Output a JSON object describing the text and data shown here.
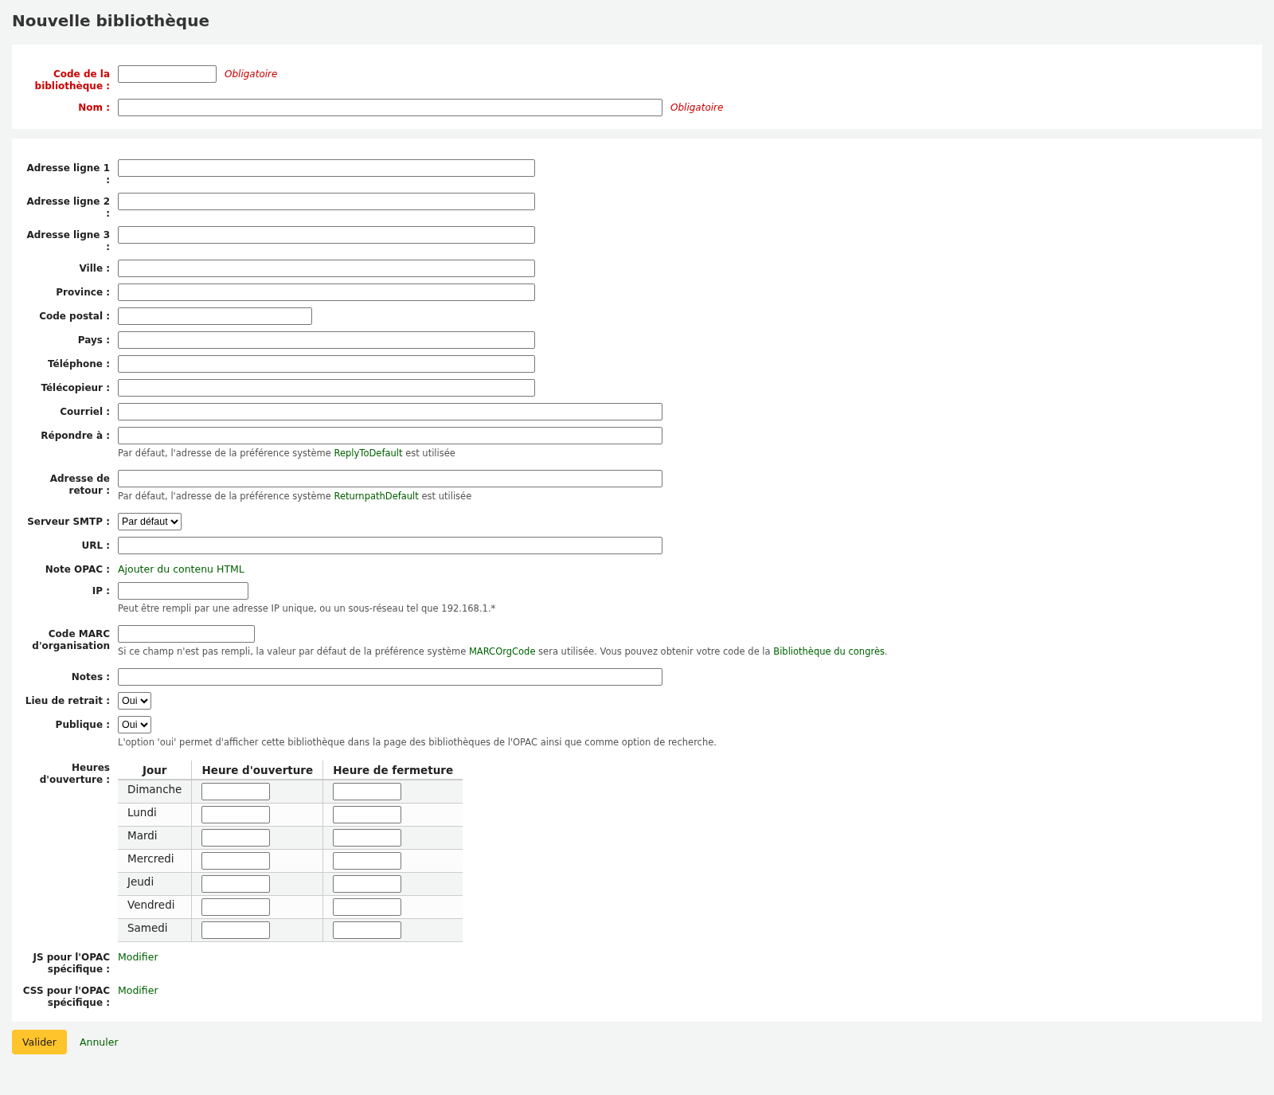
{
  "title": "Nouvelle bibliothèque",
  "required_section": [
    {
      "label": "Code de la bibliothèque :",
      "kind": "short",
      "required_note": "Obligatoire"
    },
    {
      "label": "Nom :",
      "kind": "wide",
      "required_note": "Obligatoire"
    }
  ],
  "fields": [
    {
      "label": "Adresse ligne 1 :",
      "kind": "medium"
    },
    {
      "label": "Adresse ligne 2 :",
      "kind": "medium"
    },
    {
      "label": "Adresse ligne 3 :",
      "kind": "medium"
    },
    {
      "label": "Ville :",
      "kind": "medium"
    },
    {
      "label": "Province :",
      "kind": "medium"
    },
    {
      "label": "Code postal :",
      "kind": "postal"
    },
    {
      "label": "Pays :",
      "kind": "medium"
    },
    {
      "label": "Téléphone :",
      "kind": "medium"
    },
    {
      "label": "Télécopieur :",
      "kind": "medium"
    },
    {
      "label": "Courriel :",
      "kind": "wide"
    },
    {
      "label": "Répondre à :",
      "kind": "wide",
      "hint": [
        {
          "kind": "text",
          "text": "Par défaut, l'adresse de la préférence système "
        },
        {
          "kind": "link",
          "text": "ReplyToDefault"
        },
        {
          "kind": "text",
          "text": " est utilisée"
        }
      ]
    },
    {
      "label": "Adresse de retour :",
      "kind": "wide",
      "hint": [
        {
          "kind": "text",
          "text": "Par défaut, l'adresse de la préférence système "
        },
        {
          "kind": "link",
          "text": "ReturnpathDefault"
        },
        {
          "kind": "text",
          "text": " est utilisée"
        }
      ]
    },
    {
      "label": "Serveur SMTP :",
      "kind": "select",
      "value": "Par défaut"
    },
    {
      "label": "URL :",
      "kind": "wide"
    },
    {
      "label": "Note OPAC :",
      "kind": "link",
      "value": "Ajouter du contenu HTML"
    },
    {
      "label": "IP :",
      "kind": "ip",
      "hint": [
        {
          "kind": "text",
          "text": "Peut être rempli par une adresse IP unique, ou un sous-réseau tel que 192.168.1.*"
        }
      ]
    },
    {
      "label": "Code MARC d'organisation",
      "kind": "marc",
      "hint": [
        {
          "kind": "text",
          "text": "Si ce champ n'est pas rempli, la valeur par défaut de la préférence système "
        },
        {
          "kind": "link",
          "text": "MARCOrgCode"
        },
        {
          "kind": "text",
          "text": " sera utilisée. Vous pouvez obtenir votre code de la "
        },
        {
          "kind": "link",
          "text": "Bibliothèque du congrès"
        },
        {
          "kind": "text",
          "text": "."
        }
      ]
    },
    {
      "label": "Notes :",
      "kind": "wide"
    },
    {
      "label": "Lieu de retrait :",
      "kind": "select",
      "value": "Oui"
    },
    {
      "label": "Publique :",
      "kind": "select",
      "value": "Oui",
      "hint": [
        {
          "kind": "text",
          "text": "L'option 'oui' permet d'afficher cette bibliothèque dans la page des bibliothèques de l'OPAC ainsi que comme option de recherche."
        }
      ]
    },
    {
      "label": "Heures d'ouverture :",
      "kind": "hours"
    },
    {
      "label": "JS pour l'OPAC spécifique :",
      "kind": "link",
      "value": "Modifier"
    },
    {
      "label": "CSS pour l'OPAC spécifique :",
      "kind": "link",
      "value": "Modifier"
    }
  ],
  "hours_table": {
    "columns": [
      "Jour",
      "Heure d'ouverture",
      "Heure de fermeture"
    ],
    "rows": [
      "Dimanche",
      "Lundi",
      "Mardi",
      "Mercredi",
      "Jeudi",
      "Vendredi",
      "Samedi"
    ]
  },
  "actions": {
    "submit": "Valider",
    "cancel": "Annuler"
  }
}
